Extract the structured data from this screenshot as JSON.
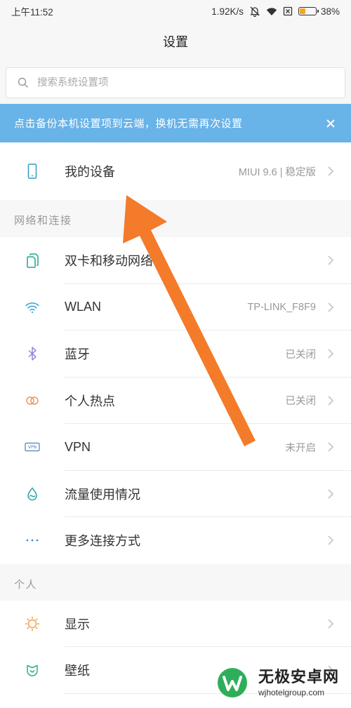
{
  "status_bar": {
    "time": "上午11:52",
    "net_speed": "1.92K/s",
    "icons": [
      "silent-mode-icon",
      "wifi-icon",
      "no-sim-icon",
      "battery-icon"
    ],
    "battery_percent": "38%",
    "battery_level": 0.38,
    "battery_color": "#f5a623"
  },
  "header": {
    "title": "设置"
  },
  "search": {
    "placeholder": "搜索系统设置项",
    "icon": "search-icon"
  },
  "banner": {
    "text": "点击备份本机设置项到云端，换机无需再次设置",
    "icon": "close-icon",
    "color": "#68b3e8"
  },
  "device": {
    "label": "我的设备",
    "value": "MIUI 9.6 | 稳定版",
    "icon": "phone-icon",
    "icon_color": "#2e9fc1"
  },
  "sections": [
    {
      "title": "网络和连接",
      "items": [
        {
          "label": "双卡和移动网络",
          "icon": "dual-sim-icon",
          "icon_color": "#22a697"
        },
        {
          "label": "WLAN",
          "value": "TP-LINK_F8F9",
          "icon": "wifi-icon",
          "icon_color": "#35a4d4"
        },
        {
          "label": "蓝牙",
          "value": "已关闭",
          "icon": "bluetooth-icon",
          "icon_color": "#8c80d9"
        },
        {
          "label": "个人热点",
          "value": "已关闭",
          "icon": "hotspot-icon",
          "icon_color": "#f0955c"
        },
        {
          "label": "VPN",
          "value": "未开启",
          "icon": "vpn-icon",
          "icon_label": "VPN",
          "icon_color": "#4f80b6"
        },
        {
          "label": "流量使用情况",
          "icon": "data-usage-icon",
          "icon_color": "#2ba4a6"
        },
        {
          "label": "更多连接方式",
          "icon": "more-icon",
          "icon_color": "#3b8fd6"
        }
      ]
    },
    {
      "title": "个人",
      "items": [
        {
          "label": "显示",
          "icon": "display-icon",
          "icon_color": "#f1a04c"
        },
        {
          "label": "壁纸",
          "icon": "wallpaper-icon",
          "icon_color": "#2daf8f"
        }
      ]
    }
  ],
  "watermark": {
    "name": "无极安卓网",
    "url": "wjhotelgroup.com",
    "logo": "wuji-logo",
    "color": "#2fae5a"
  },
  "annotation": {
    "arrow_color": "#f47b2a"
  }
}
